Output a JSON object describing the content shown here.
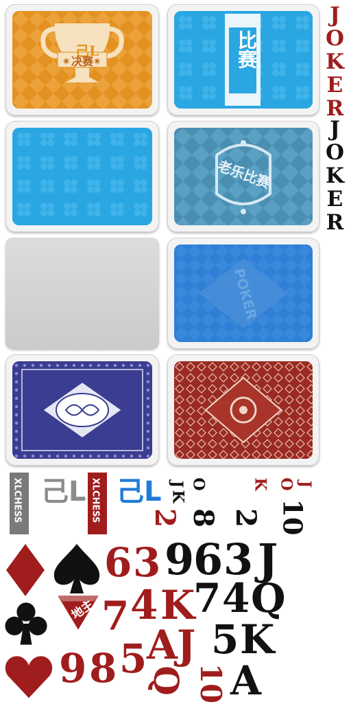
{
  "card_backs": {
    "trophy_card": {
      "logo": "己L",
      "banner": "决赛",
      "star_left": "✳",
      "star_right": "✳"
    },
    "match_card": {
      "text": "比赛"
    },
    "plain_blue_card": {},
    "arena_card": {
      "text": "老乐比赛"
    },
    "blank_gray_card": {},
    "poker_card": {
      "text": "POKER"
    },
    "classic_blue_card": {},
    "classic_red_card": {}
  },
  "joker_labels": {
    "red": "JOKER",
    "black": "JOKER"
  },
  "brand": {
    "name": "XLCHESS",
    "logo": "己L"
  },
  "landlord": {
    "text": "地主"
  },
  "ranks": {
    "red_top": [
      "J",
      "O",
      "K"
    ],
    "red_2": "2",
    "red_6": "6",
    "red_3": "3",
    "red_7": "7",
    "red_4": "4",
    "red_K": "K",
    "red_9": "9",
    "red_8": "8",
    "red_5": "5",
    "red_A": "A",
    "red_J": "J",
    "red_Q": "Q",
    "red_10": "10",
    "black_top": [
      "J",
      "O",
      "K"
    ],
    "black_8": "8",
    "black_2": "2",
    "black_10": "10",
    "black_9": "9",
    "black_6": "6",
    "black_3": "3",
    "black_J": "J",
    "black_7": "7",
    "black_4": "4",
    "black_Q": "Q",
    "black_5": "5",
    "black_K": "K",
    "black_A": "A"
  },
  "colors": {
    "red": "#a01d1d",
    "black": "#111111",
    "orange": "#e59b28",
    "blue": "#2aa6e2",
    "teal": "#4a93b5",
    "navy": "#3a3d91",
    "maroon": "#9a2a22"
  }
}
